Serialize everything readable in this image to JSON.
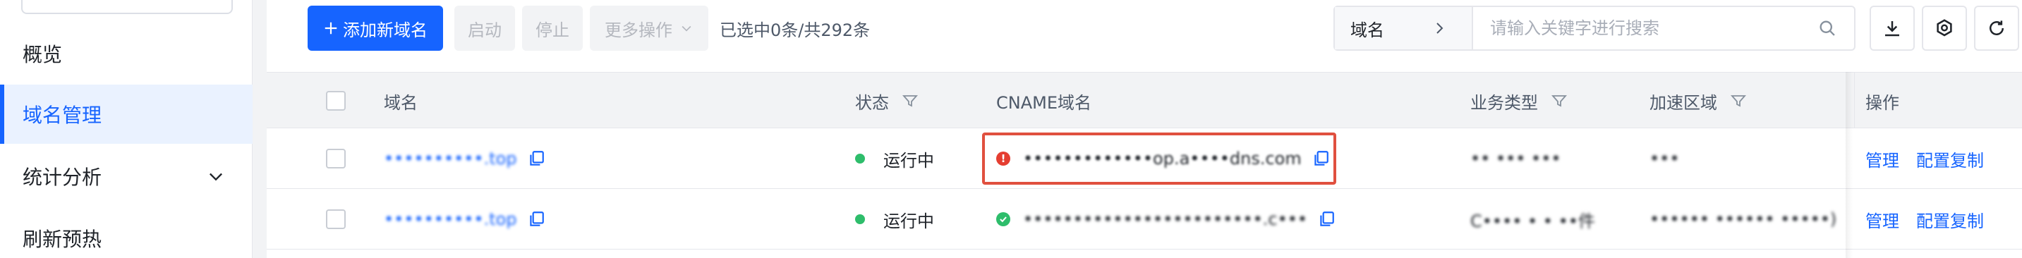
{
  "sidebar": {
    "search_value": "",
    "items": [
      {
        "label": "概览",
        "active": false
      },
      {
        "label": "域名管理",
        "active": true
      },
      {
        "label": "统计分析",
        "active": false,
        "expandable": true
      },
      {
        "label": "刷新预热",
        "active": false
      }
    ]
  },
  "toolbar": {
    "add_label": "添加新域名",
    "add_icon": "plus-icon",
    "start_label": "启动",
    "stop_label": "停止",
    "more_label": "更多操作",
    "selection_text": "已选中0条/共292条",
    "search_field": "域名",
    "search_placeholder": "请输入关键字进行搜索",
    "search_value": ""
  },
  "table": {
    "headers": {
      "domain": "域名",
      "status": "状态",
      "cname": "CNAME域名",
      "business": "业务类型",
      "region": "加速区域",
      "actions": "操作"
    },
    "rows": [
      {
        "domain": "••••••••••.top",
        "status": "运行中",
        "status_color": "#2ebd6b",
        "cname": "•••••••••••••op.a••••dns.com",
        "cname_state": "error",
        "business": "•• ••• •••",
        "region": "•••",
        "action_manage": "管理",
        "action_copy": "配置复制"
      },
      {
        "domain": "••••••••••.top",
        "status": "运行中",
        "status_color": "#2ebd6b",
        "cname": "••••••••••••••••••••••••.c•••",
        "cname_state": "ok",
        "business": "C•••• • • ••件",
        "region": "•••••• •••••• •••••)",
        "action_manage": "管理",
        "action_copy": "配置复制"
      }
    ]
  },
  "colors": {
    "primary": "#1664ff",
    "error": "#e53e31",
    "success": "#2ebd6b",
    "highlight_border": "#e0503f"
  }
}
